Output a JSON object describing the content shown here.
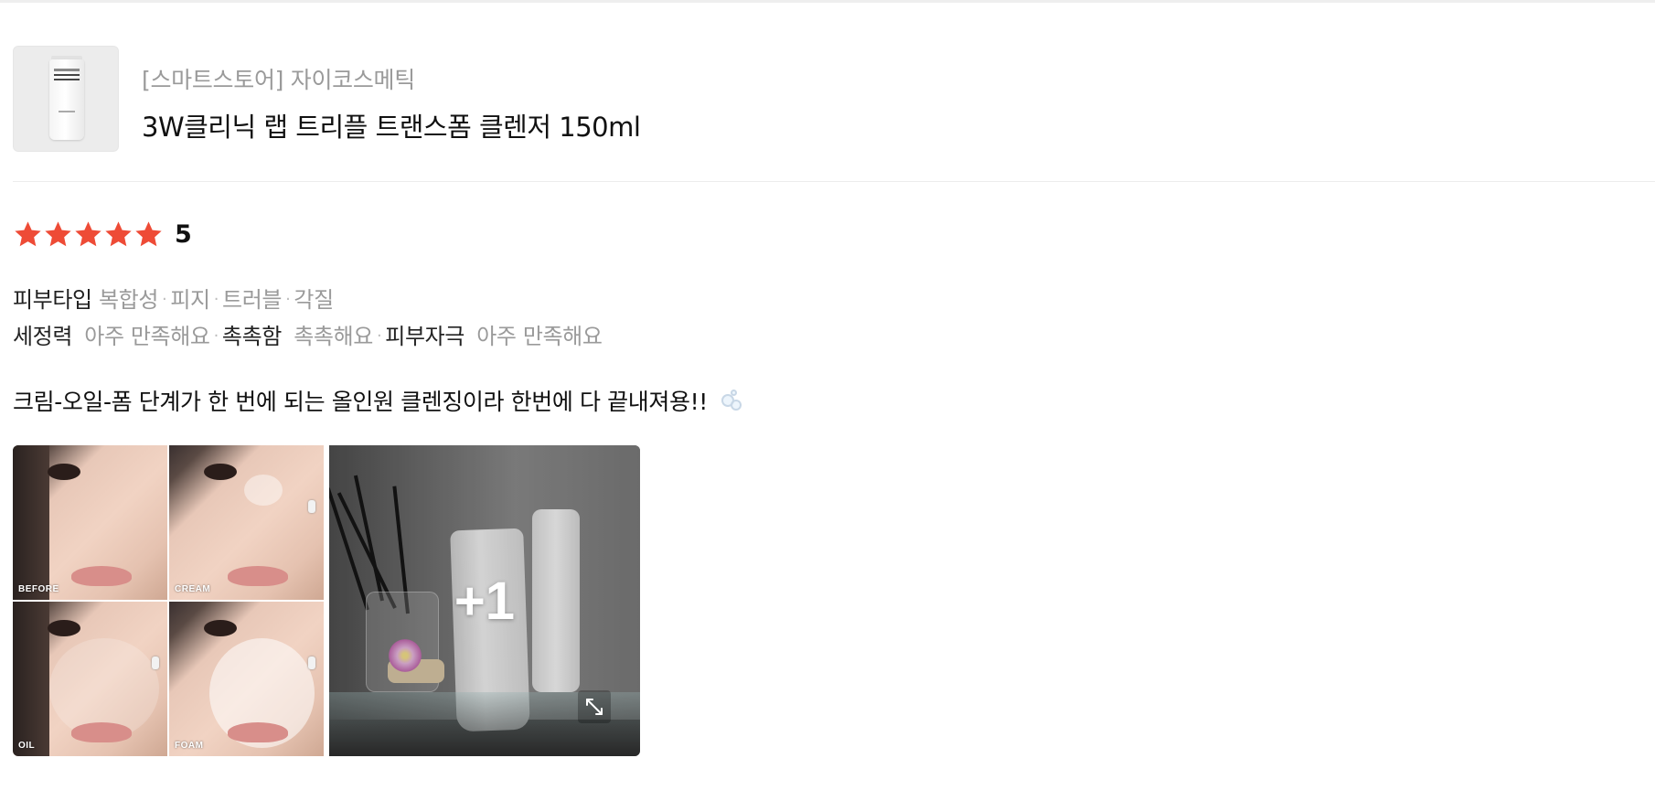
{
  "product": {
    "store": "[스마트스토어] 자이코스메틱",
    "name": "3W클리닉 랩 트리플 트랜스폼 클렌저 150ml",
    "thumbnail": "cleanser-tube-image"
  },
  "rating": {
    "value": 5,
    "max": 5,
    "display": "5",
    "star_color": "#ee4b36"
  },
  "attributes": {
    "skin_type": {
      "label": "피부타입",
      "values": [
        "복합성",
        "피지",
        "트러블",
        "각질"
      ]
    },
    "cleansing": {
      "label": "세정력",
      "value": "아주 만족해요"
    },
    "moisture": {
      "label": "촉촉함",
      "value": "촉촉해요"
    },
    "irritation": {
      "label": "피부자극",
      "value": "아주 만족해요"
    }
  },
  "review": {
    "text": "크림-오일-폼 단계가 한 번에 되는 올인원 클렌징이라 한번에 다 끝내져용!!",
    "emoji": "bubbles"
  },
  "photos": {
    "grid_labels": [
      "BEFORE",
      "CREAM",
      "OIL",
      "FOAM"
    ],
    "more_count": "+1",
    "expand_icon": "expand-icon"
  }
}
